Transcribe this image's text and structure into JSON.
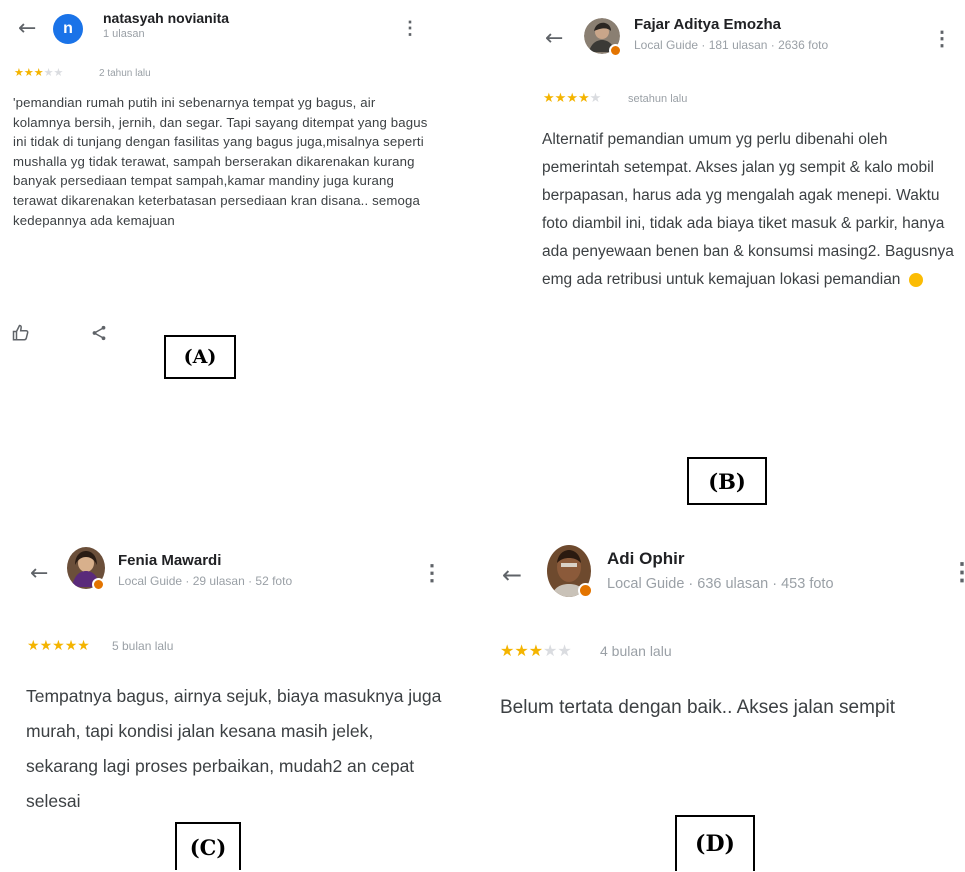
{
  "panels": [
    {
      "id": "A",
      "label": "(A)",
      "avatar_letter": "n",
      "user_name": "natasyah novianita",
      "user_meta": "1 ulasan",
      "rating": 3,
      "when": "2 tahun lalu",
      "review": "'pemandian rumah putih ini sebenarnya tempat yg bagus, air kolamnya bersih, jernih, dan segar. Tapi sayang ditempat yang bagus ini tidak di tunjang dengan fasilitas yang bagus juga,misalnya seperti mushalla yg tidak terawat, sampah berserakan dikarenakan kurang banyak persediaan tempat sampah,kamar mandiny juga kurang terawat dikarenakan keterbatasan persediaan kran disana.. semoga kedepannya ada kemajuan",
      "actions": [
        "like-icon",
        "share-icon"
      ]
    },
    {
      "id": "B",
      "label": "(B)",
      "user_name": "Fajar Aditya Emozha",
      "user_meta": "Local Guide · 181 ulasan · 2636 foto",
      "rating": 4,
      "when": "setahun lalu",
      "review": "Alternatif pemandian umum yg perlu dibenahi oleh pemerintah setempat. Akses jalan yg sempit & kalo mobil berpapasan, harus ada yg mengalah agak menepi. Waktu foto diambil ini, tidak ada biaya tiket masuk & parkir, hanya ada penyewaan benen ban & konsumsi masing2. Bagusnya emg ada retribusi untuk kemajuan lokasi pemandian"
    },
    {
      "id": "C",
      "label": "(C)",
      "user_name": "Fenia Mawardi",
      "user_meta": "Local Guide · 29 ulasan · 52 foto",
      "rating": 5,
      "when": "5 bulan lalu",
      "review": "Tempatnya bagus, airnya sejuk, biaya masuknya juga murah, tapi kondisi jalan kesana masih jelek, sekarang lagi proses perbaikan, mudah2 an cepat selesai"
    },
    {
      "id": "D",
      "label": "(D)",
      "user_name": "Adi Ophir",
      "user_meta": "Local Guide · 636 ulasan · 453 foto",
      "rating": 3,
      "when": "4 bulan lalu",
      "review": "Belum tertata dengan baik.. Akses jalan sempit"
    }
  ],
  "icons": {
    "back": "arrow-left-icon",
    "menu": "more-vert-icon",
    "star": "star-icon",
    "local_guide": "local-guide-badge-icon",
    "hand": "waving-hand-icon"
  },
  "colors": {
    "star_on": "#f4b400",
    "star_off": "#dadce0",
    "avatar_letter_bg": "#1a73e8",
    "local_guide_badge": "#e37400",
    "meta_text": "#9aa0a6"
  }
}
